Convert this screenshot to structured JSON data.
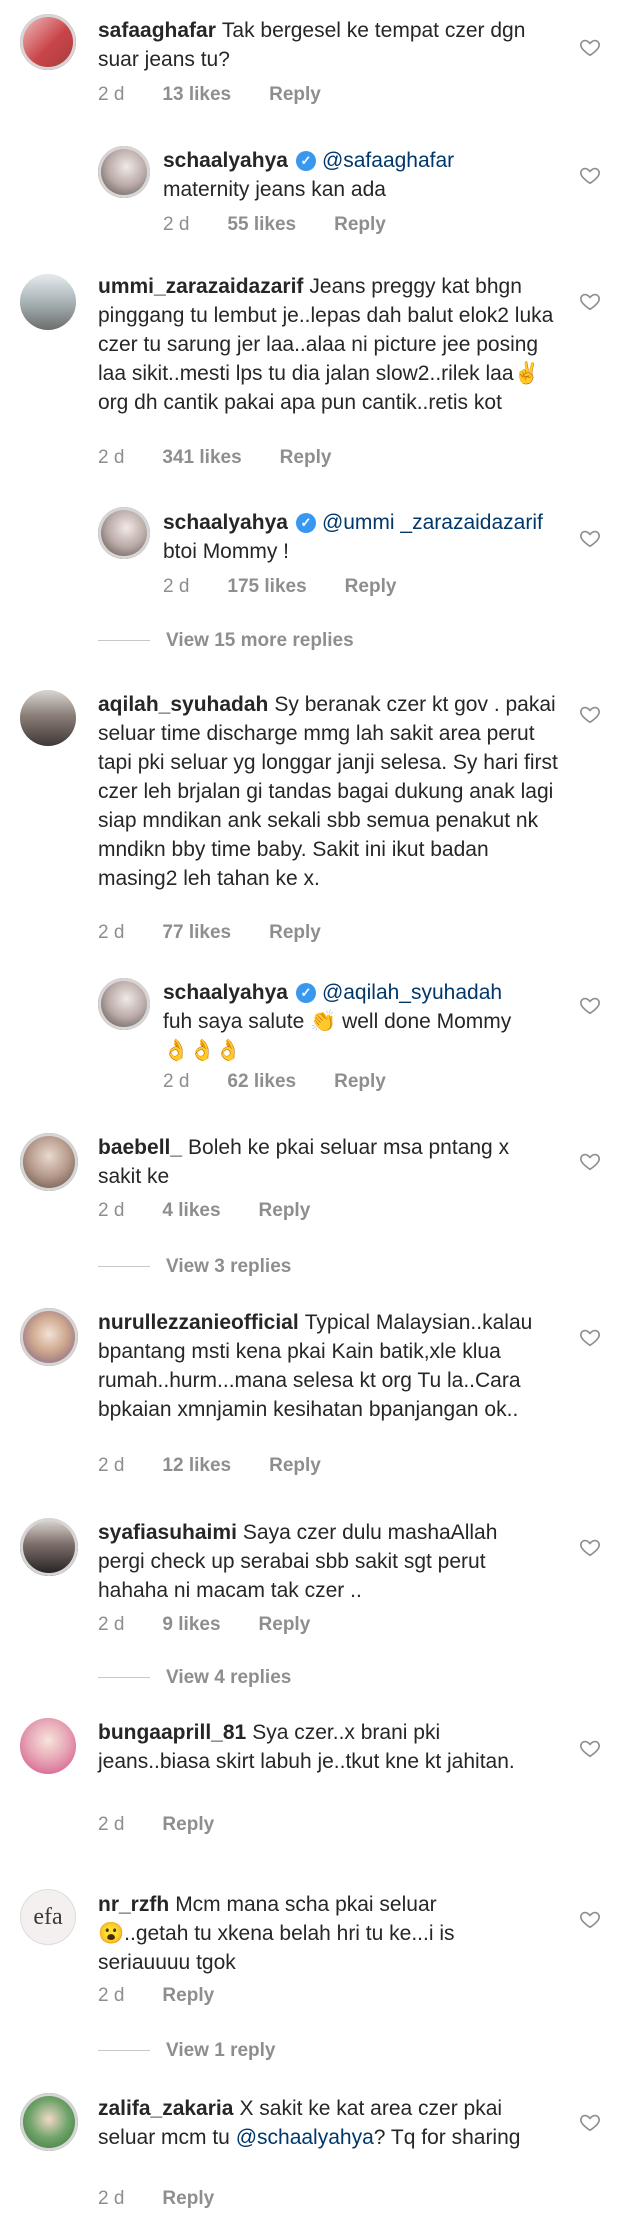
{
  "comments": [
    {
      "user": "safaaghafar",
      "text": "Tak bergesel ke tempat czer dgn suar jeans tu?",
      "time": "2 d",
      "likes": "13 likes",
      "reply": "Reply"
    },
    {
      "user": "schaalyahya",
      "mention": "@safaaghafar",
      "text": "maternity jeans kan ada",
      "time": "2 d",
      "likes": "55 likes",
      "reply": "Reply"
    },
    {
      "user": "ummi_zarazaidazarif",
      "text": "Jeans preggy kat bhgn pinggang tu lembut je..lepas dah balut elok2 luka czer tu sarung jer laa..alaa ni picture jee posing laa sikit..mesti lps tu dia jalan slow2..rilek laa✌️org dh cantik pakai apa pun cantik..retis kot",
      "time": "2 d",
      "likes": "341 likes",
      "reply": "Reply"
    },
    {
      "user": "schaalyahya",
      "mention": "@ummi _zarazaidazarif",
      "text": "btoi Mommy !",
      "time": "2 d",
      "likes": "175 likes",
      "reply": "Reply"
    },
    {
      "view_replies": "View 15 more replies"
    },
    {
      "user": "aqilah_syuhadah",
      "text": "Sy beranak czer kt gov . pakai seluar time discharge mmg lah sakit area perut tapi pki seluar yg longgar janji selesa. Sy hari first czer leh brjalan gi tandas bagai dukung anak lagi siap mndikan ank sekali sbb semua penakut nk mndikn bby time baby. Sakit ini ikut badan masing2 leh tahan ke x.",
      "time": "2 d",
      "likes": "77 likes",
      "reply": "Reply"
    },
    {
      "user": "schaalyahya",
      "mention": "@aqilah_syuhadah",
      "text": "fuh saya salute 👏 well done Mommy 👌👌👌",
      "time": "2 d",
      "likes": "62 likes",
      "reply": "Reply"
    },
    {
      "user": "baebell_",
      "text": "Boleh ke pkai seluar msa pntang x sakit ke",
      "time": "2 d",
      "likes": "4 likes",
      "reply": "Reply"
    },
    {
      "view_replies": "View 3 replies"
    },
    {
      "user": "nurullezzanieofficial",
      "text": "Typical Malaysian..kalau bpantang msti kena pkai Kain batik,xle klua rumah..hurm...mana selesa kt org Tu la..Cara bpkaian xmnjamin kesihatan bpanjangan ok..",
      "time": "2 d",
      "likes": "12 likes",
      "reply": "Reply"
    },
    {
      "user": "syafiasuhaimi",
      "text": "Saya czer dulu mashaAllah pergi check up serabai sbb sakit sgt perut hahaha ni macam tak czer ..",
      "time": "2 d",
      "likes": "9 likes",
      "reply": "Reply"
    },
    {
      "view_replies": "View 4 replies"
    },
    {
      "user": "bungaaprill_81",
      "text": "Sya czer..x brani pki jeans..biasa skirt labuh je..tkut kne kt jahitan.",
      "time": "2 d",
      "reply": "Reply"
    },
    {
      "user": "nr_rzfh",
      "text": "Mcm mana scha pkai seluar 😮..getah tu xkena belah hri tu ke...i is seriauuuu tgok",
      "time": "2 d",
      "reply": "Reply",
      "avatar_text": "efa"
    },
    {
      "view_replies": "View 1 reply"
    },
    {
      "user": "zalifa_zakaria",
      "text": "X sakit ke kat area czer pkai seluar mcm tu ",
      "mention_end": "@schaalyahya",
      "text_end": "? Tq for sharing",
      "time": "2 d",
      "reply": "Reply"
    }
  ],
  "colors": {
    "text": "#262626",
    "meta": "#8e8e8e",
    "mention": "#00376b",
    "verified": "#3897f0"
  }
}
